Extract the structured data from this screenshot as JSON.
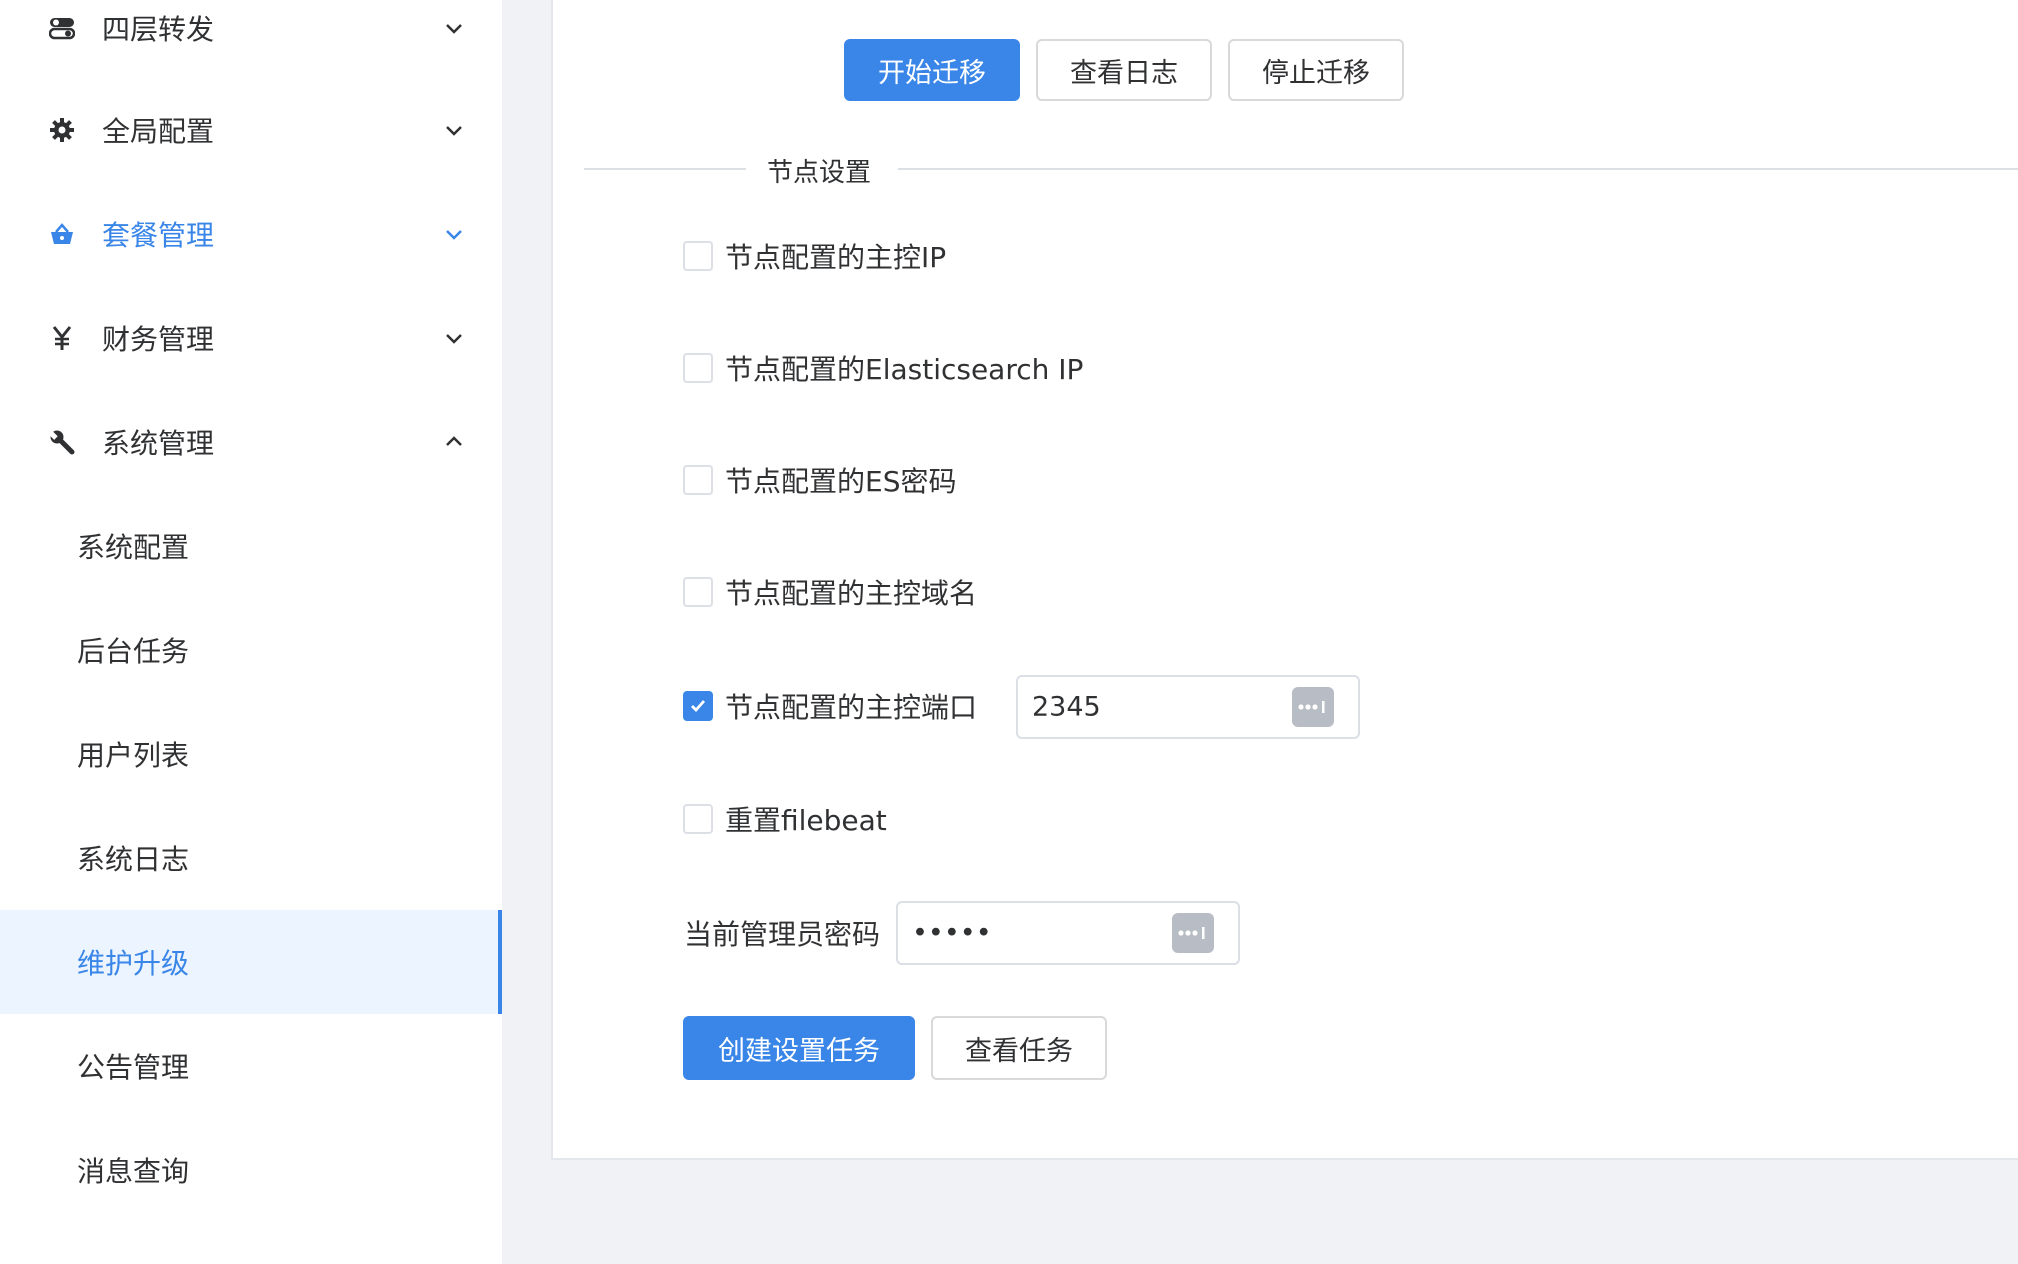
{
  "sidebar": {
    "menus": [
      {
        "label": "四层转发",
        "icon": "toggle-icon",
        "expanded": false
      },
      {
        "label": "全局配置",
        "icon": "gear-icon",
        "expanded": false
      },
      {
        "label": "套餐管理",
        "icon": "basket-icon",
        "expanded": false
      },
      {
        "label": "财务管理",
        "icon": "yen-icon",
        "expanded": false
      },
      {
        "label": "系统管理",
        "icon": "wrench-icon",
        "expanded": true
      }
    ],
    "submenu": [
      {
        "label": "系统配置"
      },
      {
        "label": "后台任务"
      },
      {
        "label": "用户列表"
      },
      {
        "label": "系统日志"
      },
      {
        "label": "维护升级",
        "selected": true
      },
      {
        "label": "公告管理"
      },
      {
        "label": "消息查询"
      }
    ],
    "accent_color": "#3a86e8"
  },
  "migration": {
    "start_label": "开始迁移",
    "view_log_label": "查看日志",
    "stop_label": "停止迁移"
  },
  "node_settings": {
    "divider_title": "节点设置",
    "options": [
      {
        "label": "节点配置的主控IP",
        "checked": false
      },
      {
        "label": "节点配置的Elasticsearch IP",
        "checked": false
      },
      {
        "label": "节点配置的ES密码",
        "checked": false
      },
      {
        "label": "节点配置的主控域名",
        "checked": false
      },
      {
        "label": "节点配置的主控端口",
        "checked": true,
        "value": "2345"
      },
      {
        "label": "重置filebeat",
        "checked": false
      }
    ],
    "admin_password_label": "当前管理员密码",
    "admin_password_value": "•••••",
    "create_task_label": "创建设置任务",
    "view_task_label": "查看任务"
  }
}
